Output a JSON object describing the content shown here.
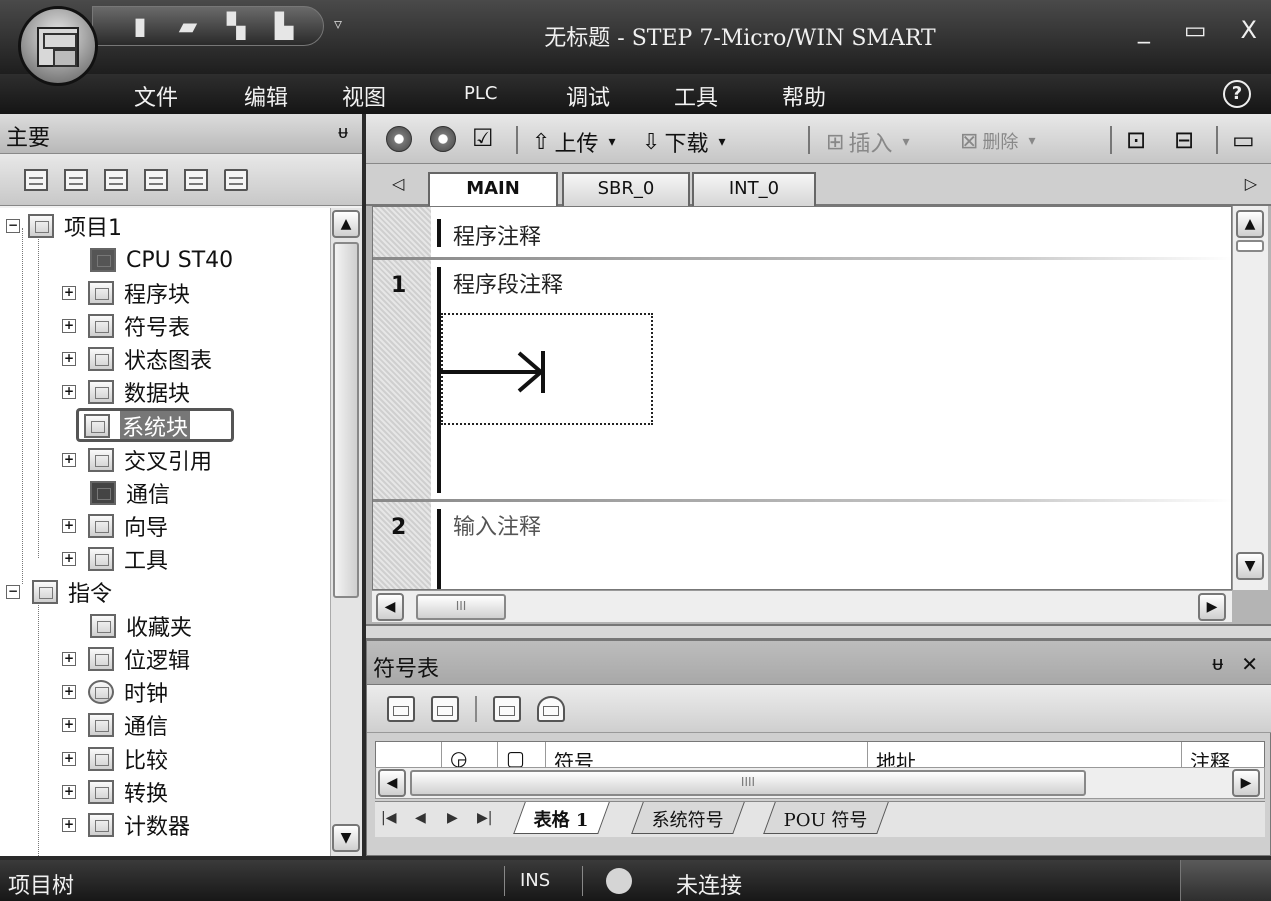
{
  "window": {
    "title": "无标题 - STEP 7-Micro/WIN SMART",
    "controls": [
      "_",
      "▭",
      "X"
    ]
  },
  "quick_access": [
    "new-icon",
    "open-icon",
    "save-icon",
    "print-icon"
  ],
  "menu": [
    "文件",
    "编辑",
    "视图",
    "PLC",
    "调试",
    "工具",
    "帮助"
  ],
  "left_pane": {
    "title": "主要",
    "pin": "ᵾ",
    "tree": [
      {
        "label": "项目1",
        "expander": "−"
      },
      {
        "label": "CPU ST40",
        "expander": ""
      },
      {
        "label": "程序块",
        "expander": "+"
      },
      {
        "label": "符号表",
        "expander": "+"
      },
      {
        "label": "状态图表",
        "expander": "+"
      },
      {
        "label": "数据块",
        "expander": "+"
      },
      {
        "label": "系统块",
        "expander": ""
      },
      {
        "label": "交叉引用",
        "expander": "+"
      },
      {
        "label": "通信",
        "expander": ""
      },
      {
        "label": "向导",
        "expander": "+"
      },
      {
        "label": "工具",
        "expander": "+"
      },
      {
        "label": "指令",
        "expander": "−"
      },
      {
        "label": "收藏夹",
        "expander": ""
      },
      {
        "label": "位逻辑",
        "expander": "+"
      },
      {
        "label": "时钟",
        "expander": "+"
      },
      {
        "label": "通信",
        "expander": "+"
      },
      {
        "label": "比较",
        "expander": "+"
      },
      {
        "label": "转换",
        "expander": "+"
      },
      {
        "label": "计数器",
        "expander": "+"
      }
    ]
  },
  "editor": {
    "toolbar": {
      "upload": "上传",
      "download": "下载",
      "insert": "插入",
      "delete": "删除"
    },
    "tabs": [
      "MAIN",
      "SBR_0",
      "INT_0"
    ],
    "program_comment": "程序注释",
    "networks": [
      {
        "number": "1",
        "comment": "程序段注释"
      },
      {
        "number": "2",
        "comment": "输入注释"
      }
    ]
  },
  "symbol_table": {
    "title": "符号表",
    "columns": [
      "符号",
      "地址",
      "注释"
    ],
    "sheets": [
      "表格 1",
      "系统符号",
      "POU 符号"
    ]
  },
  "status_bar": {
    "left": "项目树",
    "mode": "INS",
    "connection": "未连接"
  }
}
